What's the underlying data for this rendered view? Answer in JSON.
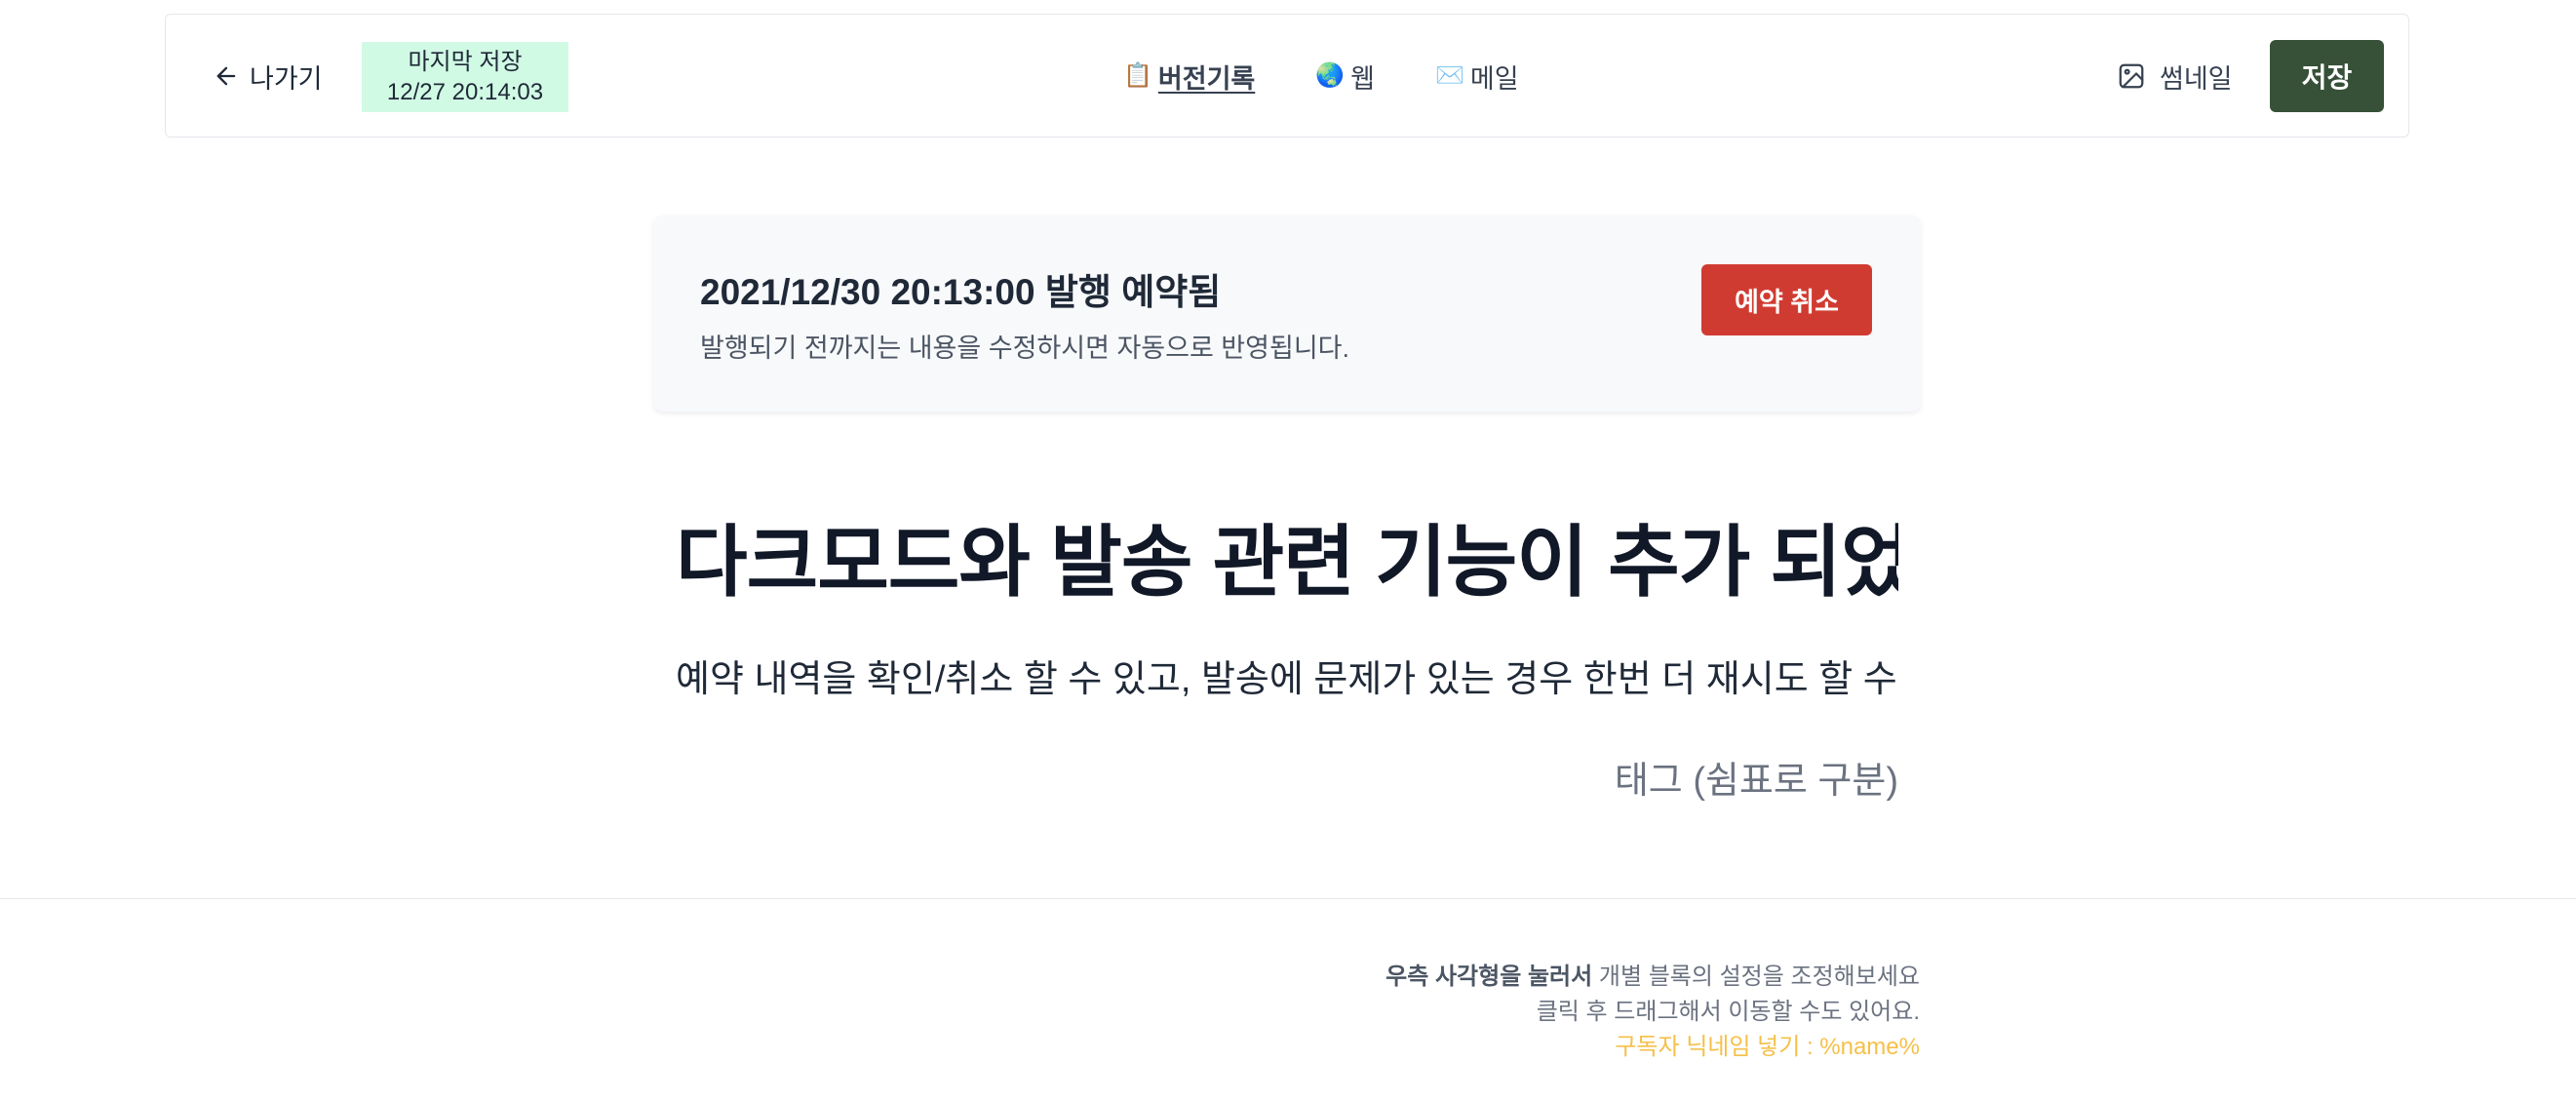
{
  "toolbar": {
    "back_label": "나가기",
    "saved_label": "마지막 저장",
    "saved_time": "12/27 20:14:03",
    "nav": [
      {
        "icon": "📋",
        "label": "버전기록",
        "active": true
      },
      {
        "icon": "🌏",
        "label": "웹",
        "active": false
      },
      {
        "icon": "✉️",
        "label": "메일",
        "active": false
      }
    ],
    "thumbnail_label": "썸네일",
    "save_label": "저장"
  },
  "schedule": {
    "title": "2021/12/30 20:13:00 발행 예약됨",
    "subtitle": "발행되기 전까지는 내용을 수정하시면 자동으로 반영됩니다.",
    "cancel_label": "예약 취소"
  },
  "editor": {
    "title": "다크모드와 발송 관련 기능이 추가 되었어요",
    "subtitle": "예약 내역을 확인/취소 할 수 있고, 발송에 문제가 있는 경우 한번 더 재시도 할 수 있어요",
    "tag_placeholder": "태그 (쉼표로 구분)"
  },
  "hints": {
    "line1_bold": "우측 사각형을 눌러서",
    "line1_rest": " 개별 블록의 설정을 조정해보세요",
    "line2": "클릭 후 드래그해서 이동할 수도 있어요.",
    "line3": "구독자 닉네임 넣기 : %name%"
  },
  "colors": {
    "save_button": "#365138",
    "cancel_button": "#d03b31",
    "saved_badge_bg": "#d1fae5",
    "hint_highlight": "#f5c04a"
  }
}
